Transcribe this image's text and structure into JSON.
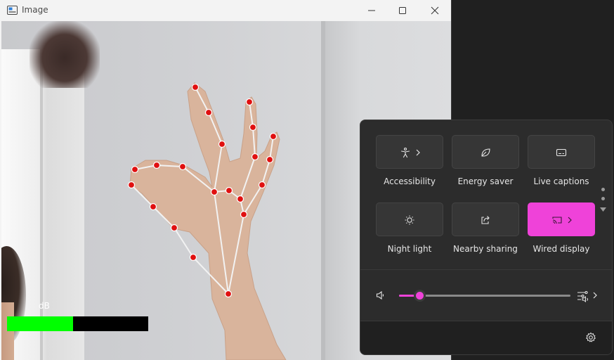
{
  "window": {
    "title": "Image",
    "icon": "image-window-icon",
    "controls": [
      "minimize-icon",
      "maximize-icon",
      "close-icon"
    ]
  },
  "overlay": {
    "db_label": "dB",
    "meter_level": 0.47,
    "meter_color": "#00ff00",
    "landmark_color": "#e01010",
    "connection_color": "#f2f2f2"
  },
  "quick_settings": {
    "accent": "#ef42d9",
    "tiles": [
      {
        "label": "Accessibility",
        "icon": "accessibility-icon",
        "has_chevron": true,
        "active": false
      },
      {
        "label": "Energy saver",
        "icon": "energy-saver-leaf-icon",
        "has_chevron": false,
        "active": false
      },
      {
        "label": "Live captions",
        "icon": "captions-icon",
        "has_chevron": false,
        "active": false
      },
      {
        "label": "Night light",
        "icon": "night-light-icon",
        "has_chevron": false,
        "active": false
      },
      {
        "label": "Nearby sharing",
        "icon": "share-icon",
        "has_chevron": false,
        "active": false
      },
      {
        "label": "Wired display",
        "icon": "cast-display-icon",
        "has_chevron": true,
        "active": true
      }
    ],
    "volume": {
      "level": 0.12,
      "icon": "speaker-icon",
      "output_icon": "audio-output-settings-icon"
    },
    "footer_icon": "settings-gear-icon"
  }
}
